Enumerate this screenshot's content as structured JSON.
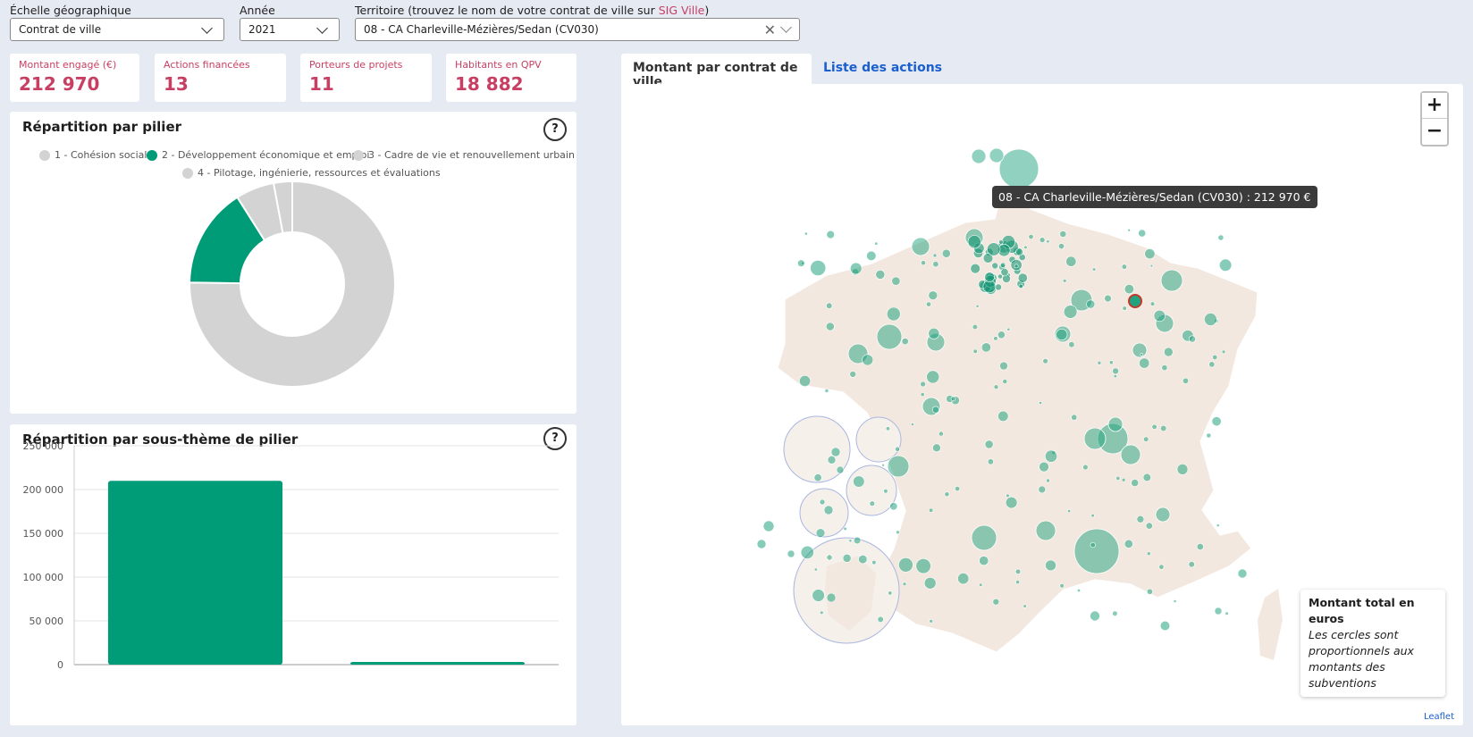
{
  "filters": {
    "scale": {
      "label": "Échelle géographique",
      "value": "Contrat de ville"
    },
    "year": {
      "label": "Année",
      "value": "2021"
    },
    "territory": {
      "label_prefix": "Territoire (trouvez le nom de votre contrat de ville sur ",
      "link": "SIG Ville",
      "label_suffix": ")",
      "value": "08 - CA Charleville-Mézières/Sedan (CV030)"
    }
  },
  "kpis": [
    {
      "label": "Montant engagé (€)",
      "value": "212 970"
    },
    {
      "label": "Actions financées",
      "value": "13"
    },
    {
      "label": "Porteurs de projets",
      "value": "11"
    },
    {
      "label": "Habitants en QPV",
      "value": "18 882"
    }
  ],
  "colors": {
    "accent": "#c83f63",
    "green": "#009b77",
    "grey": "#d3d3d3",
    "link": "#1a5fd0"
  },
  "pie_card": {
    "title": "Répartition par pilier",
    "help": "?"
  },
  "bar_card": {
    "title": "Répartition par sous-thème de pilier",
    "help": "?"
  },
  "map_panel": {
    "tabs": [
      "Montant par contrat de ville",
      "Liste des actions"
    ],
    "zoom_in": "+",
    "zoom_out": "−",
    "tooltip": "08 - CA Charleville-Mézières/Sedan (CV030) : 212 970 €",
    "legend_title": "Montant total en euros",
    "legend_text": "Les cercles sont proportionnels aux montants des subventions",
    "attribution": "Leaflet"
  },
  "chart_data": [
    {
      "type": "pie",
      "title": "Répartition par pilier",
      "labels": [
        "1 - Cohésion sociale",
        "2 - Développement économique et emploi",
        "3 - Cadre de vie et renouvellement urbain",
        "4 - Pilotage, ingénierie, ressources et évaluations"
      ],
      "values": [
        155000,
        32500,
        12500,
        6000
      ],
      "colors": [
        "#d3d3d3",
        "#009b77",
        "#d3d3d3",
        "#d3d3d3"
      ],
      "legend_position": "top"
    },
    {
      "type": "bar",
      "title": "Répartition par sous-thème de pilier",
      "categories": [
        "",
        ""
      ],
      "values": [
        210000,
        3000
      ],
      "ylim": [
        0,
        250000
      ],
      "yticks": [
        "0",
        "50 000",
        "100 000",
        "150 000",
        "200 000",
        "250 000"
      ],
      "grid": true
    }
  ]
}
